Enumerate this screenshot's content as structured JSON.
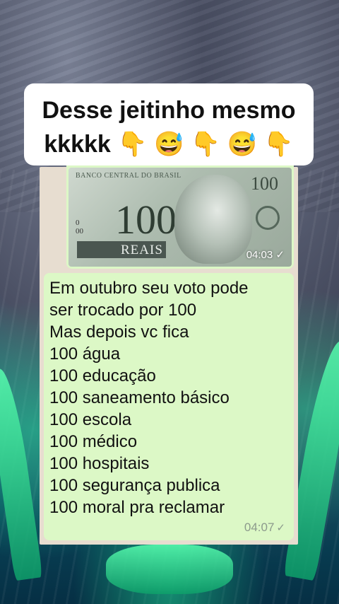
{
  "caption": {
    "line1": "Desse jeitinho mesmo",
    "line2": "kkkkk 👇 😅 👇 😅 👇"
  },
  "image_message": {
    "note_bank_text": "BANCO CENTRAL DO BRASIL",
    "note_value_small": "100",
    "note_value_big": "100",
    "note_currency": "REAIS",
    "timestamp": "04:03",
    "check_icon": "✓"
  },
  "text_message": {
    "lines": [
      "Em outubro seu voto pode",
      "ser trocado por 100",
      "Mas depois vc fica",
      "100 água",
      "100 educação",
      "100 saneamento básico",
      "100 escola",
      "100 médico",
      "100 hospitais",
      "100 segurança publica",
      "100 moral pra reclamar"
    ],
    "timestamp": "04:07",
    "check_icon": "✓"
  },
  "colors": {
    "bubble": "#dcf8c6",
    "caption_bg": "#ffffff",
    "timestamp": "#8c9a8c"
  }
}
